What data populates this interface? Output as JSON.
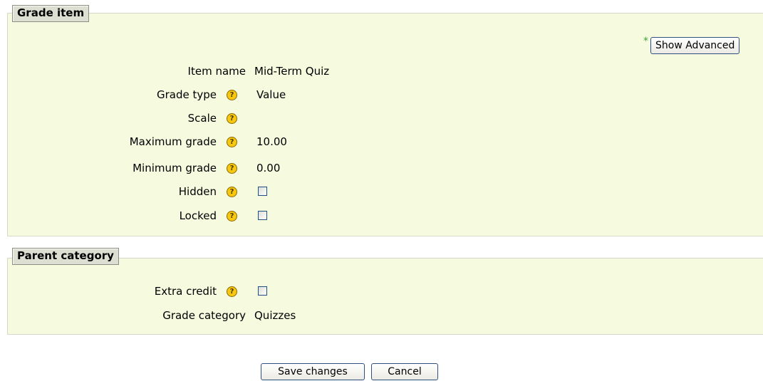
{
  "grade_item": {
    "legend": "Grade item",
    "show_advanced_marker": "*",
    "show_advanced_label": "Show Advanced",
    "fields": {
      "item_name": {
        "label": "Item name",
        "value": "Mid-Term Quiz"
      },
      "grade_type": {
        "label": "Grade type",
        "value": "Value"
      },
      "scale": {
        "label": "Scale",
        "value": ""
      },
      "maximum_grade": {
        "label": "Maximum grade",
        "value": "10.00"
      },
      "minimum_grade": {
        "label": "Minimum grade",
        "value": "0.00"
      },
      "hidden": {
        "label": "Hidden",
        "checked": false
      },
      "locked": {
        "label": "Locked",
        "checked": false
      }
    }
  },
  "parent_category": {
    "legend": "Parent category",
    "fields": {
      "extra_credit": {
        "label": "Extra credit",
        "checked": false
      },
      "grade_category": {
        "label": "Grade category",
        "value": "Quizzes"
      }
    }
  },
  "buttons": {
    "save": "Save changes",
    "cancel": "Cancel"
  },
  "icons": {
    "help": "help-icon",
    "help_glyph": "?"
  }
}
